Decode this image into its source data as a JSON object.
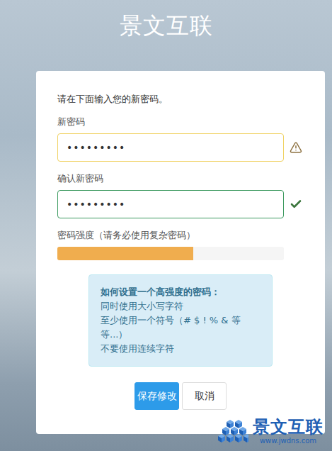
{
  "page": {
    "title": "景文互联"
  },
  "form": {
    "intro": "请在下面输入您的新密码。",
    "fields": [
      {
        "label": "新密码",
        "value": "•••••••••",
        "status": "warning"
      },
      {
        "label": "确认新密码",
        "value": "•••••••••",
        "status": "success"
      }
    ],
    "strength": {
      "label": "密码强度（请务必使用复杂密码）",
      "level": 0.6
    },
    "tips": {
      "title": "如何设置一个高强度的密码：",
      "lines": [
        "同时使用大小写字符",
        "至少使用一个符号（# $ ! % & 等",
        "等...）",
        "不要使用连续字符"
      ]
    },
    "buttons": [
      {
        "label": "保存修改",
        "primary": true
      },
      {
        "label": "取消",
        "primary": false
      }
    ]
  },
  "watermark": {
    "name": "景文互联",
    "url": "www.jwdns.com"
  }
}
